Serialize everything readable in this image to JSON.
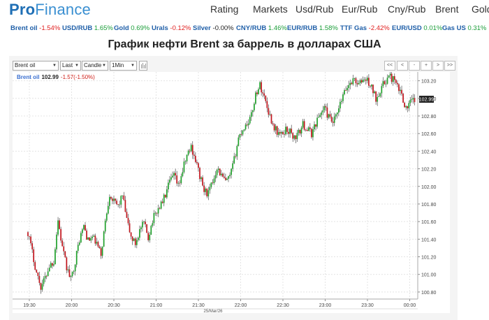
{
  "logo": {
    "part1": "Pro",
    "part2": "Finance"
  },
  "nav": [
    "Rating",
    "Markets",
    "Usd/Rub",
    "Eur/Rub",
    "Cny/Rub",
    "Brent",
    "Gold"
  ],
  "ticker": [
    {
      "name": "Brent oil",
      "change": "-1.54%",
      "dir": "neg"
    },
    {
      "name": "USD/RUB",
      "change": "1.65%",
      "dir": "pos"
    },
    {
      "name": "Gold",
      "change": "0.69%",
      "dir": "pos"
    },
    {
      "name": "Urals",
      "change": "-0.12%",
      "dir": "neg"
    },
    {
      "name": "Silver",
      "change": "-0.00%",
      "dir": "zero"
    },
    {
      "name": "CNY/RUB",
      "change": "1.46%",
      "dir": "pos"
    },
    {
      "name": "EUR/RUB",
      "change": "1.58%",
      "dir": "pos"
    },
    {
      "name": "TTF Gas",
      "change": "-2.42%",
      "dir": "neg"
    },
    {
      "name": "EUR/USD",
      "change": "0.01%",
      "dir": "pos"
    },
    {
      "name": "Gas US",
      "change": "0.31%",
      "dir": "pos"
    }
  ],
  "page_title": "График нефти Brent за баррель в долларах США",
  "toolbar": {
    "instrument": "Brent oil",
    "price_type": "Last",
    "chart_type": "Candle",
    "interval": "1Min",
    "nav_buttons": [
      "<<",
      "<",
      "-",
      "+",
      ">",
      ">>"
    ]
  },
  "colors": {
    "up": "#1ea02a",
    "down": "#c0141c",
    "accent": "#1f6fb5"
  },
  "chart_data": {
    "type": "candlestick",
    "legend": {
      "name": "Brent oil",
      "price": "102.99",
      "change": "-1.57(-1.50%)"
    },
    "last_price_label": "102.99",
    "date_label": "25/Mar/26",
    "x_ticks": [
      "19:30",
      "20:00",
      "20:30",
      "21:00",
      "21:30",
      "22:00",
      "22:30",
      "23:00",
      "23:30",
      "00:00"
    ],
    "y_ticks": [
      "100.80",
      "101.00",
      "101.20",
      "101.40",
      "101.60",
      "101.80",
      "102.00",
      "102.20",
      "102.40",
      "102.60",
      "102.80",
      "103.00",
      "103.20"
    ],
    "ylim": [
      100.72,
      103.3
    ],
    "grid": true,
    "path": [
      [
        0,
        101.48
      ],
      [
        3,
        101.25
      ],
      [
        6,
        101.02
      ],
      [
        9,
        100.86
      ],
      [
        12,
        100.96
      ],
      [
        15,
        101.1
      ],
      [
        18,
        101.15
      ],
      [
        21,
        101.62
      ],
      [
        24,
        101.3
      ],
      [
        27,
        101.08
      ],
      [
        30,
        100.94
      ],
      [
        33,
        101.15
      ],
      [
        36,
        101.4
      ],
      [
        39,
        101.55
      ],
      [
        42,
        101.38
      ],
      [
        45,
        101.42
      ],
      [
        48,
        101.35
      ],
      [
        51,
        101.22
      ],
      [
        54,
        101.6
      ],
      [
        57,
        101.92
      ],
      [
        60,
        101.82
      ],
      [
        63,
        101.78
      ],
      [
        66,
        101.9
      ],
      [
        69,
        101.62
      ],
      [
        72,
        101.42
      ],
      [
        75,
        101.35
      ],
      [
        78,
        101.5
      ],
      [
        81,
        101.58
      ],
      [
        84,
        101.42
      ],
      [
        87,
        101.62
      ],
      [
        90,
        101.72
      ],
      [
        93,
        101.8
      ],
      [
        96,
        101.9
      ],
      [
        99,
        102.05
      ],
      [
        102,
        102.12
      ],
      [
        105,
        102.0
      ],
      [
        108,
        102.18
      ],
      [
        111,
        102.35
      ],
      [
        114,
        102.45
      ],
      [
        117,
        102.3
      ],
      [
        120,
        102.12
      ],
      [
        123,
        101.95
      ],
      [
        126,
        101.92
      ],
      [
        129,
        102.05
      ],
      [
        132,
        102.22
      ],
      [
        135,
        102.12
      ],
      [
        138,
        102.05
      ],
      [
        141,
        102.1
      ],
      [
        144,
        102.3
      ],
      [
        147,
        102.55
      ],
      [
        150,
        102.65
      ],
      [
        153,
        102.72
      ],
      [
        156,
        102.8
      ],
      [
        159,
        103.05
      ],
      [
        162,
        103.15
      ],
      [
        165,
        103.02
      ],
      [
        168,
        102.85
      ],
      [
        171,
        102.7
      ],
      [
        174,
        102.62
      ],
      [
        177,
        102.58
      ],
      [
        180,
        102.65
      ],
      [
        183,
        102.62
      ],
      [
        186,
        102.55
      ],
      [
        189,
        102.6
      ],
      [
        192,
        102.7
      ],
      [
        195,
        102.65
      ],
      [
        198,
        102.6
      ],
      [
        201,
        102.72
      ],
      [
        204,
        102.82
      ],
      [
        207,
        102.9
      ],
      [
        210,
        102.78
      ],
      [
        213,
        102.72
      ],
      [
        216,
        102.82
      ],
      [
        219,
        102.98
      ],
      [
        222,
        103.1
      ],
      [
        225,
        103.18
      ],
      [
        228,
        103.22
      ],
      [
        231,
        103.15
      ],
      [
        234,
        103.22
      ],
      [
        237,
        103.2
      ],
      [
        240,
        103.12
      ],
      [
        243,
        103.0
      ],
      [
        246,
        103.1
      ],
      [
        249,
        103.18
      ],
      [
        252,
        103.25
      ],
      [
        255,
        103.22
      ],
      [
        258,
        103.12
      ],
      [
        261,
        103.05
      ],
      [
        264,
        102.88
      ],
      [
        267,
        102.95
      ],
      [
        270,
        102.99
      ]
    ]
  }
}
